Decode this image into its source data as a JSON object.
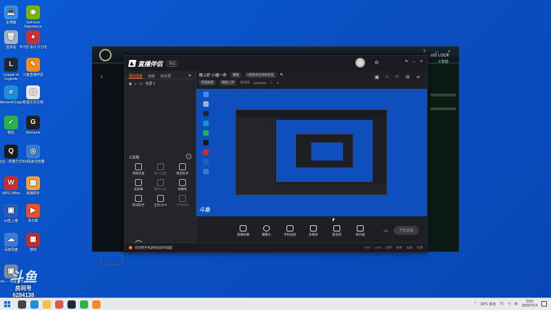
{
  "desktop": {
    "icons": [
      {
        "name": "此电脑",
        "color": "#3b8fe8",
        "glyph": "💻"
      },
      {
        "name": "回收站",
        "color": "#9fb4c8",
        "glyph": "🗑"
      },
      {
        "name": "League of Legends",
        "color": "#1b2a38",
        "glyph": "L"
      },
      {
        "name": "Microsoft Edge",
        "color": "#1d8fd6",
        "glyph": "e"
      },
      {
        "name": "微信",
        "color": "#2bb34a",
        "glyph": "✓"
      },
      {
        "name": "QQ - 快捷方式",
        "color": "#1a1a1a",
        "glyph": "Q"
      },
      {
        "name": "WPS Office",
        "color": "#d22b2b",
        "glyph": "W"
      },
      {
        "name": "lyl直上播",
        "color": "#2a5fb8",
        "glyph": "▣"
      },
      {
        "name": "百度网盘",
        "color": "#3a7bd5",
        "glyph": "☁"
      },
      {
        "name": "GeForce Experience",
        "color": "#76b900",
        "glyph": "◉"
      },
      {
        "name": "하이엔 홀라 이건데",
        "color": "#c8303a",
        "glyph": "♠"
      },
      {
        "name": "斗鱼直播伴侣",
        "color": "#f28a1c",
        "glyph": "✎"
      },
      {
        "name": "新建文本文档",
        "color": "#e8e8e8",
        "glyph": "▤"
      },
      {
        "name": "WeGame",
        "color": "#222",
        "glyph": "G"
      },
      {
        "name": "360极速浏览器",
        "color": "#3a7bd5",
        "glyph": "◎"
      },
      {
        "name": "易播助手",
        "color": "#eaa23c",
        "glyph": "▦"
      },
      {
        "name": "向日葵",
        "color": "#e8502a",
        "glyph": "▶"
      },
      {
        "name": "游戏",
        "color": "#c42a2a",
        "glyph": "▦"
      },
      {
        "name": "bcls — 快捷方式",
        "color": "#7a8aa0",
        "glyph": "▣"
      }
    ]
  },
  "game_window": {
    "right_label": "vs5 LOOK",
    "right_sub": "4 秒前"
  },
  "app": {
    "logo_text": "直播伴侣",
    "version_badge": "测试",
    "left_tabs": [
      "我的场景",
      "面板",
      "组合框"
    ],
    "scene_label": "全屏 1",
    "tools_title": "工具箱",
    "tools": [
      {
        "label": "视频连麦",
        "muted": false
      },
      {
        "label": "多人连麦",
        "muted": true
      },
      {
        "label": "情侣助手",
        "muted": false
      },
      {
        "label": "投屏幕",
        "muted": false
      },
      {
        "label": "图片分享",
        "muted": true
      },
      {
        "label": "弹幕机",
        "muted": false
      },
      {
        "label": "歌词助手",
        "muted": false
      },
      {
        "label": "全民斗PK",
        "muted": false
      },
      {
        "label": "文件共享",
        "muted": true
      }
    ],
    "upper_live_label": "上车一起玩",
    "stream_title": "晚上好 小播一命",
    "mode_tag": "横版",
    "category_tag": "#选择适合你的标签",
    "sub_tags": [
      "英雄联盟",
      "网络上传"
    ],
    "room_label": "房间号",
    "room_number": "6284138",
    "fans_count": "0",
    "toolbar": [
      {
        "label": "直播屏幕"
      },
      {
        "label": "摄像头"
      },
      {
        "label": "手机投屏"
      },
      {
        "label": "多媒体"
      },
      {
        "label": "麦克风"
      },
      {
        "label": "扬声器"
      }
    ],
    "start_button": "开始直播",
    "notice_text": "如何把手机游戏投屏到电脑",
    "status_stats": [
      "CPU",
      "GPU",
      "内存",
      "帧率",
      "丢帧",
      "码率"
    ]
  },
  "watermark": {
    "logo": "斗鱼",
    "room_label": "房间号",
    "room_number": "6284138"
  },
  "taskbar": {
    "weather": "33°C 多云",
    "time": "0:03",
    "date": "2022/7/14"
  }
}
